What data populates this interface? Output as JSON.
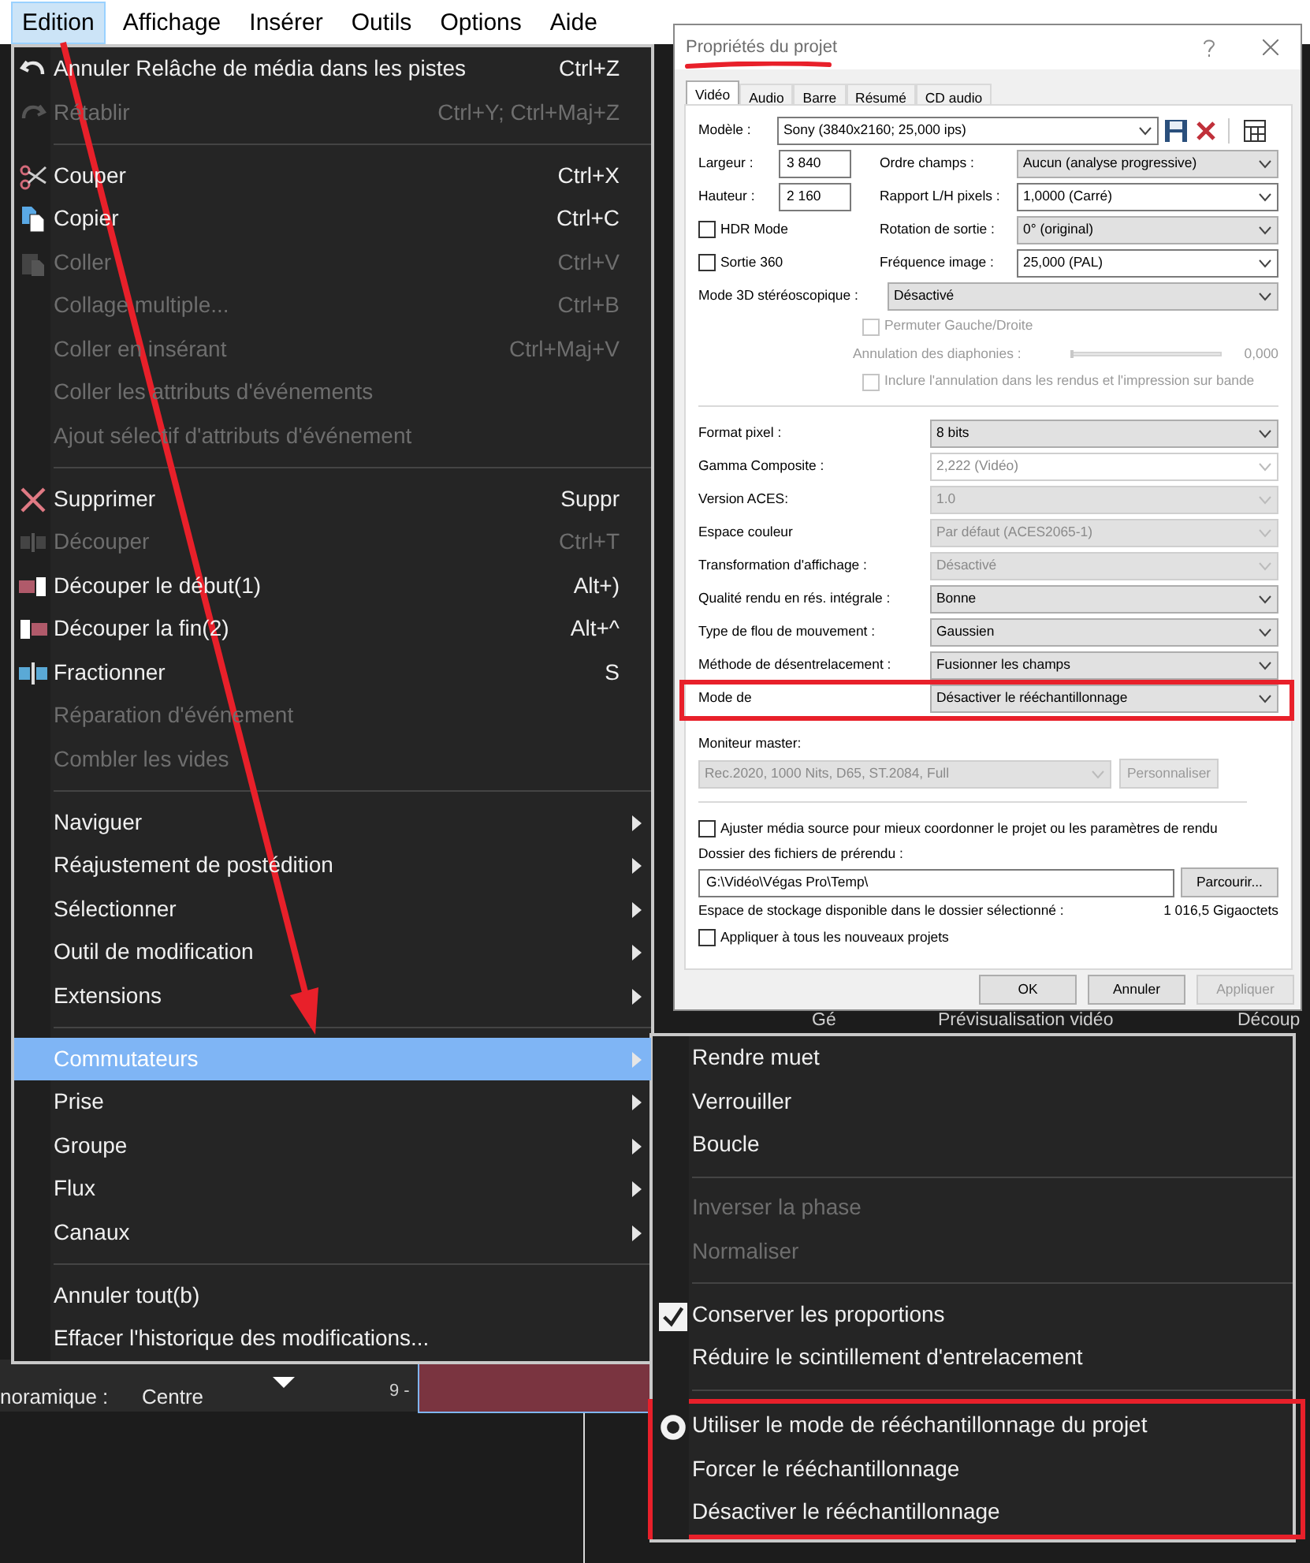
{
  "menubar": [
    {
      "label": "Edition",
      "selected": true
    },
    {
      "label": "Affichage",
      "selected": false
    },
    {
      "label": "Insérer",
      "selected": false
    },
    {
      "label": "Outils",
      "selected": false
    },
    {
      "label": "Options",
      "selected": false
    },
    {
      "label": "Aide",
      "selected": false
    }
  ],
  "edit_menu": {
    "items": [
      {
        "kind": "item",
        "label": "Annuler Relâche de média dans les pistes",
        "shortcut": "Ctrl+Z",
        "disabled": false
      },
      {
        "kind": "item",
        "label": "Rétablir",
        "shortcut": "Ctrl+Y; Ctrl+Maj+Z",
        "disabled": true
      },
      {
        "kind": "separator"
      },
      {
        "kind": "item",
        "label": "Couper",
        "shortcut": "Ctrl+X",
        "disabled": false
      },
      {
        "kind": "item",
        "label": "Copier",
        "shortcut": "Ctrl+C",
        "disabled": false
      },
      {
        "kind": "item",
        "label": "Coller",
        "shortcut": "Ctrl+V",
        "disabled": true
      },
      {
        "kind": "item",
        "label": "Collage multiple...",
        "shortcut": "Ctrl+B",
        "disabled": true
      },
      {
        "kind": "item",
        "label": "Coller en insérant",
        "shortcut": "Ctrl+Maj+V",
        "disabled": true
      },
      {
        "kind": "item",
        "label": "Coller les attributs d'événements",
        "disabled": true
      },
      {
        "kind": "item",
        "label": "Ajout sélectif d'attributs d'événement",
        "disabled": true
      },
      {
        "kind": "separator"
      },
      {
        "kind": "item",
        "label": "Supprimer",
        "shortcut": "Suppr",
        "disabled": false
      },
      {
        "kind": "item",
        "label": "Découper",
        "shortcut": "Ctrl+T",
        "disabled": true
      },
      {
        "kind": "item",
        "label": "Découper le début(1)",
        "shortcut": "Alt+)",
        "disabled": false
      },
      {
        "kind": "item",
        "label": "Découper la fin(2)",
        "shortcut": "Alt+^",
        "disabled": false
      },
      {
        "kind": "item",
        "label": "Fractionner",
        "shortcut": "S",
        "disabled": false
      },
      {
        "kind": "item",
        "label": "Réparation d'événement",
        "disabled": true
      },
      {
        "kind": "item",
        "label": "Combler les vides",
        "disabled": true
      },
      {
        "kind": "separator"
      },
      {
        "kind": "submenu",
        "label": "Naviguer",
        "selected": false
      },
      {
        "kind": "submenu",
        "label": "Réajustement de postédition",
        "selected": false
      },
      {
        "kind": "submenu",
        "label": "Sélectionner",
        "selected": false
      },
      {
        "kind": "submenu",
        "label": "Outil de modification",
        "selected": false
      },
      {
        "kind": "submenu",
        "label": "Extensions",
        "selected": false
      },
      {
        "kind": "separator"
      },
      {
        "kind": "submenu",
        "label": "Commutateurs",
        "selected": true
      },
      {
        "kind": "submenu",
        "label": "Prise",
        "selected": false
      },
      {
        "kind": "submenu",
        "label": "Groupe",
        "selected": false
      },
      {
        "kind": "submenu",
        "label": "Flux",
        "selected": false
      },
      {
        "kind": "submenu",
        "label": "Canaux",
        "selected": false
      },
      {
        "kind": "separator"
      },
      {
        "kind": "item",
        "label": "Annuler tout(b)",
        "disabled": false
      },
      {
        "kind": "item",
        "label": "Effacer l'historique des modifications...",
        "disabled": false
      }
    ]
  },
  "switches_menu": {
    "items": [
      {
        "kind": "item",
        "label": "Rendre muet",
        "disabled": false
      },
      {
        "kind": "item",
        "label": "Verrouiller",
        "disabled": false
      },
      {
        "kind": "item",
        "label": "Boucle",
        "disabled": false
      },
      {
        "kind": "separator"
      },
      {
        "kind": "item",
        "label": "Inverser la phase",
        "disabled": true
      },
      {
        "kind": "item",
        "label": "Normaliser",
        "disabled": true
      },
      {
        "kind": "separator"
      },
      {
        "kind": "check",
        "label": "Conserver les proportions",
        "checked": true
      },
      {
        "kind": "check",
        "label": "Réduire le scintillement d'entrelacement",
        "checked": false
      },
      {
        "kind": "separator"
      },
      {
        "kind": "radio",
        "label": "Utiliser le mode de rééchantillonnage du projet",
        "selected": true,
        "highlighted": true
      },
      {
        "kind": "radio",
        "label": "Forcer le rééchantillonnage",
        "selected": false,
        "highlighted": true
      },
      {
        "kind": "radio",
        "label": "Désactiver le rééchantillonnage",
        "selected": false,
        "highlighted": true
      }
    ]
  },
  "annotation_arrow": true,
  "dialog": {
    "title": "Propriétés du projet",
    "title_underlined": true,
    "tabs": [
      {
        "label": "Vidéo",
        "selected": true
      },
      {
        "label": "Audio",
        "selected": false
      },
      {
        "label": "Barre",
        "selected": false
      },
      {
        "label": "Résumé",
        "selected": false
      },
      {
        "label": "CD audio",
        "selected": false
      }
    ],
    "template": {
      "label": "Modèle :",
      "value": "Sony (3840x2160; 25,000 ips)"
    },
    "left_fields": [
      {
        "kind": "input",
        "label": "Largeur :",
        "value": "3 840"
      },
      {
        "kind": "input",
        "label": "Hauteur :",
        "value": "2 160"
      },
      {
        "kind": "checkbox",
        "label": "HDR Mode",
        "checked": false
      },
      {
        "kind": "checkbox",
        "label": "Sortie 360",
        "checked": false
      }
    ],
    "right_fields": [
      {
        "label": "Ordre champs :",
        "value": "Aucun (analyse progressive)",
        "editable": false
      },
      {
        "label": "Rapport L/H pixels :",
        "value": "1,0000 (Carré)",
        "editable": true
      },
      {
        "label": "Rotation de sortie :",
        "value": "0° (original)",
        "editable": false
      },
      {
        "label": "Fréquence image :",
        "value": "25,000 (PAL)",
        "editable": true
      }
    ],
    "stereo": {
      "label": "Mode 3D stéréoscopique :",
      "value": "Désactivé"
    },
    "stereo_options": [
      {
        "kind": "checkbox",
        "label": "Permuter Gauche/Droite",
        "checked": false,
        "disabled": true
      },
      {
        "kind": "slider",
        "label": "Annulation des diaphonies :",
        "level": 0,
        "reading": "0,000",
        "disabled": true
      },
      {
        "kind": "checkbox",
        "label": "Inclure l'annulation dans les rendus et l'impression sur bande",
        "checked": false,
        "disabled": true
      }
    ],
    "settings": [
      {
        "label": "Format pixel :",
        "value": "8 bits",
        "editable": false,
        "disabled": false,
        "highlighted": false
      },
      {
        "label": "Gamma Composite :",
        "value": "2,222 (Vidéo)",
        "editable": true,
        "disabled": true,
        "highlighted": false
      },
      {
        "label": "Version ACES:",
        "value": "1.0",
        "editable": false,
        "disabled": true,
        "highlighted": false
      },
      {
        "label": "Espace couleur",
        "value": "Par défaut (ACES2065-1)",
        "editable": false,
        "disabled": true,
        "highlighted": false
      },
      {
        "label": "Transformation d'affichage :",
        "value": "Désactivé",
        "editable": false,
        "disabled": true,
        "highlighted": false
      },
      {
        "label": "Qualité rendu en rés. intégrale :",
        "value": "Bonne",
        "editable": false,
        "disabled": false,
        "highlighted": false
      },
      {
        "label": "Type de flou de mouvement :",
        "value": "Gaussien",
        "editable": false,
        "disabled": false,
        "highlighted": false
      },
      {
        "label": "Méthode de désentrelacement :",
        "value": "Fusionner les champs",
        "editable": false,
        "disabled": false,
        "highlighted": false
      },
      {
        "label": "Mode de",
        "value": "Désactiver le rééchantillonnage",
        "editable": false,
        "disabled": false,
        "highlighted": true
      }
    ],
    "monitor": {
      "label": "Moniteur master:",
      "value": "Rec.2020, 1000 Nits, D65, ST.2084, Full",
      "disabled": true,
      "button": "Personnaliser",
      "button_disabled": true
    },
    "adjust_option": {
      "label": "Ajuster média source pour mieux coordonner le projet ou les paramètres de rendu",
      "checked": false
    },
    "folder": {
      "label": "Dossier des fichiers de prérendu :",
      "value": "G:\\Vidéo\\Végas Pro\\Temp\\",
      "button": "Parcourir..."
    },
    "storage": {
      "label": "Espace de stockage disponible dans le dossier sélectionné :",
      "reading": "1 016,5 Gigaoctets"
    },
    "apply_option": {
      "label": "Appliquer à tous les nouveaux projets",
      "checked": false
    },
    "buttons": [
      {
        "label": "OK",
        "disabled": false
      },
      {
        "label": "Annuler",
        "disabled": false
      },
      {
        "label": "Appliquer",
        "disabled": true
      }
    ]
  },
  "background": {
    "pan_label": "noramique :",
    "pan_value": "Centre",
    "track_number": "9 -",
    "tab_partial": "Gé",
    "preview_label": "Prévisualisation vidéo",
    "trim_partial": "Découp"
  }
}
